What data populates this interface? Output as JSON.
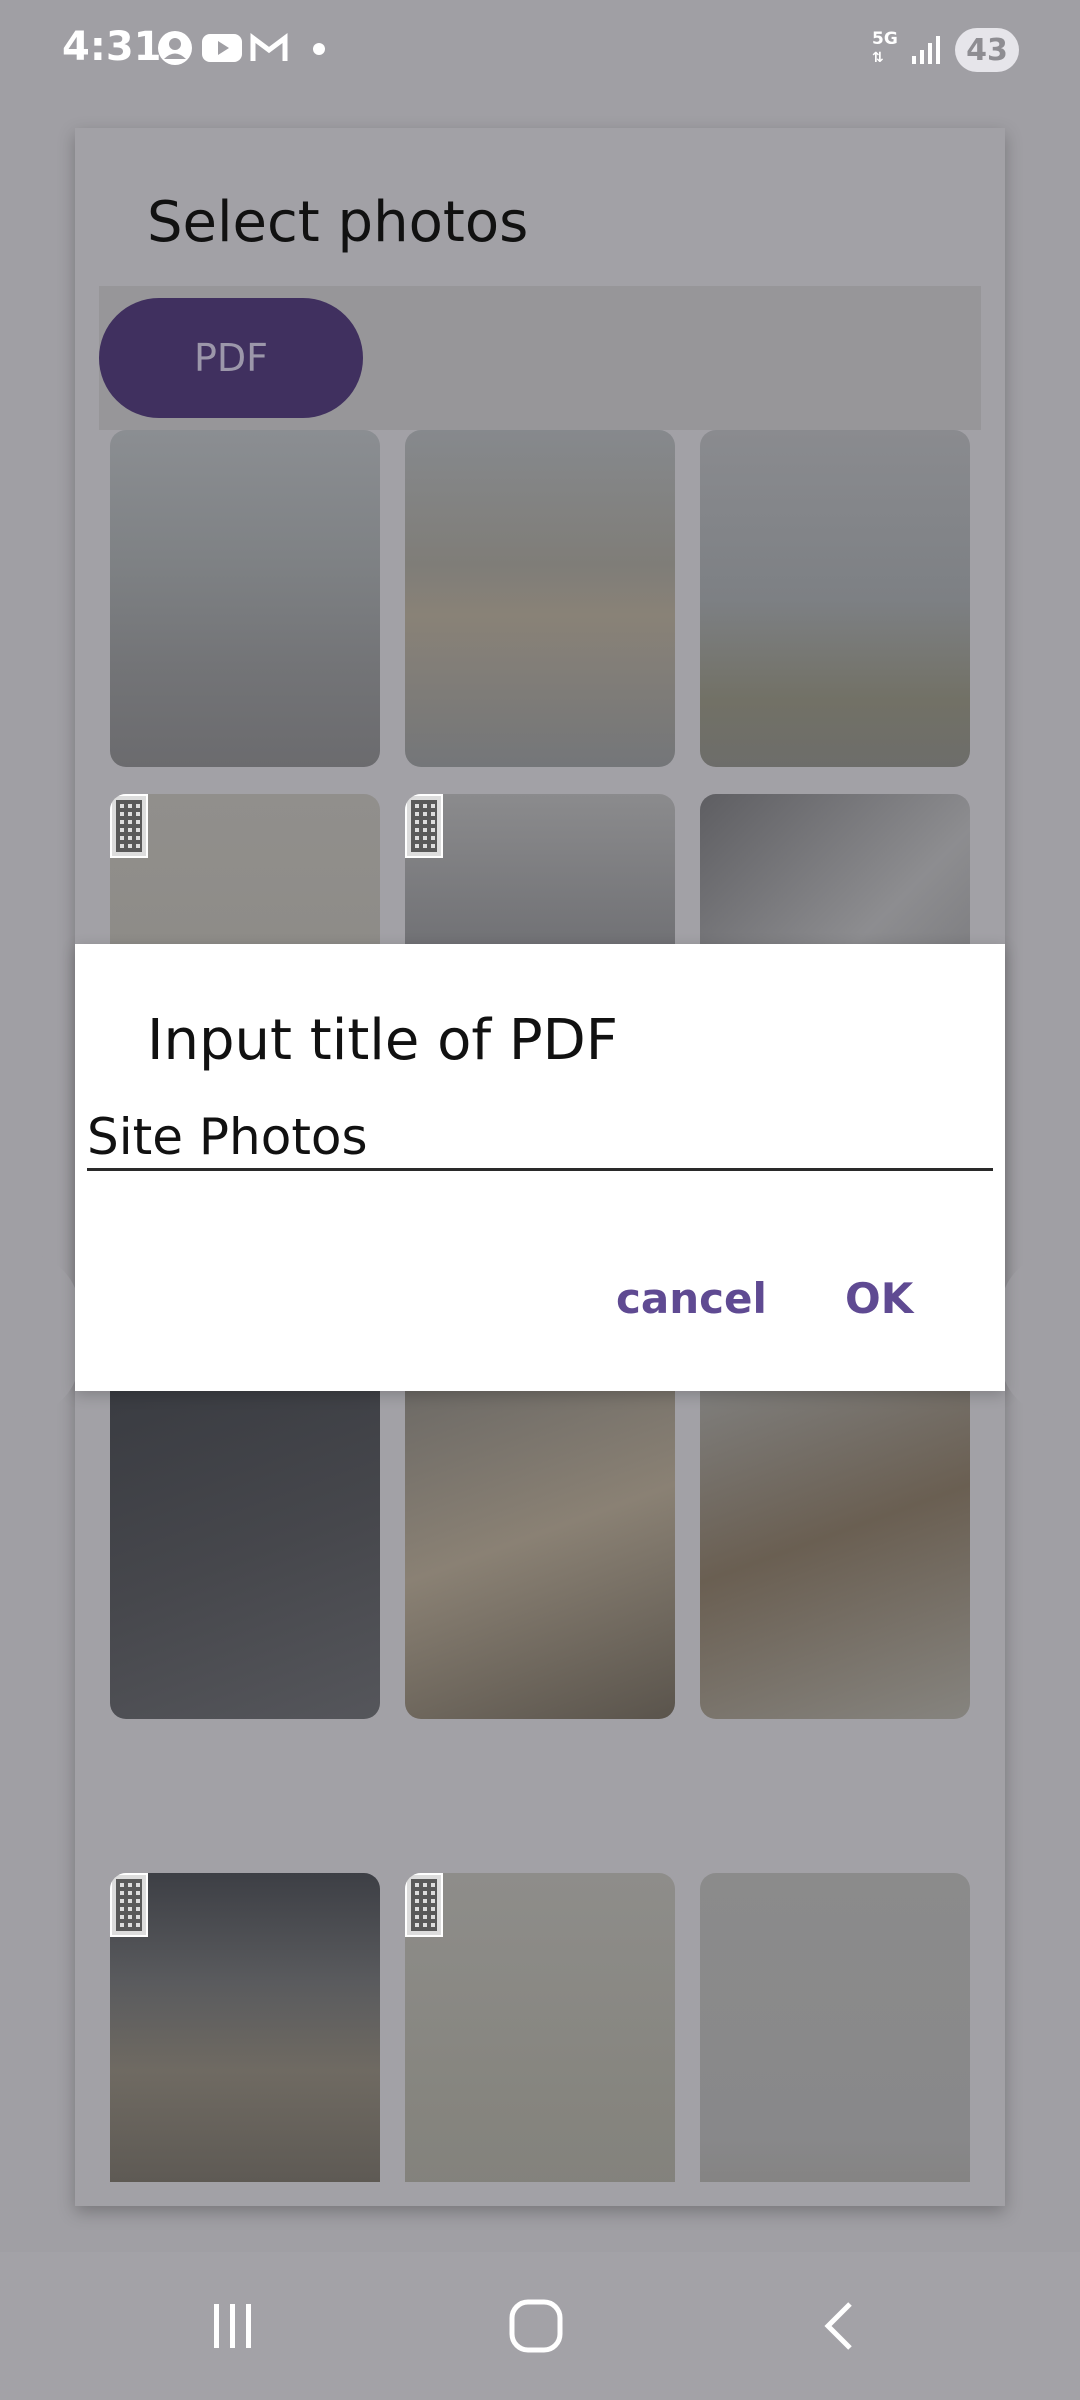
{
  "status_bar": {
    "time": "4:31",
    "network": "5G",
    "battery": "43",
    "icons": [
      "account-circle-icon",
      "youtube-icon",
      "gmail-icon",
      "notification-dot-icon",
      "signal-icon"
    ]
  },
  "screen": {
    "title": "Select photos",
    "pdf_button_label": "PDF",
    "photo_count": 15
  },
  "dialog": {
    "title": "Input title of PDF",
    "input_value": "Site Photos",
    "cancel_label": "cancel",
    "ok_label": "OK"
  },
  "nav_bar": {
    "buttons": [
      "recent-apps-icon",
      "home-icon",
      "back-icon"
    ]
  },
  "colors": {
    "accent": "#5f4a92",
    "pdf_button": "#40305f",
    "scrim": "#a09fa4",
    "dialog_bg": "#ffffff"
  }
}
